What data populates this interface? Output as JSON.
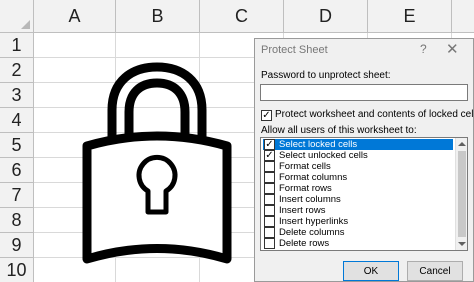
{
  "sheet": {
    "columns": [
      "A",
      "B",
      "C",
      "D",
      "E"
    ],
    "rows": [
      "1",
      "2",
      "3",
      "4",
      "5",
      "6",
      "7",
      "8",
      "9",
      "10"
    ],
    "image": "padlock-icon"
  },
  "dialog": {
    "title": "Protect Sheet",
    "help_label": "?",
    "close_label": "✕",
    "password_label": "Password to unprotect sheet:",
    "password_value": "",
    "protect_label": "Protect worksheet and contents of locked cells",
    "protect_checked": true,
    "allow_label": "Allow all users of this worksheet to:",
    "options": [
      {
        "label": "Select locked cells",
        "checked": true,
        "selected": true
      },
      {
        "label": "Select unlocked cells",
        "checked": true,
        "selected": false
      },
      {
        "label": "Format cells",
        "checked": false,
        "selected": false
      },
      {
        "label": "Format columns",
        "checked": false,
        "selected": false
      },
      {
        "label": "Format rows",
        "checked": false,
        "selected": false
      },
      {
        "label": "Insert columns",
        "checked": false,
        "selected": false
      },
      {
        "label": "Insert rows",
        "checked": false,
        "selected": false
      },
      {
        "label": "Insert hyperlinks",
        "checked": false,
        "selected": false
      },
      {
        "label": "Delete columns",
        "checked": false,
        "selected": false
      },
      {
        "label": "Delete rows",
        "checked": false,
        "selected": false
      }
    ],
    "ok_label": "OK",
    "cancel_label": "Cancel",
    "colors": {
      "selection": "#0078d7",
      "dialog_bg": "#f0f0f0"
    }
  }
}
